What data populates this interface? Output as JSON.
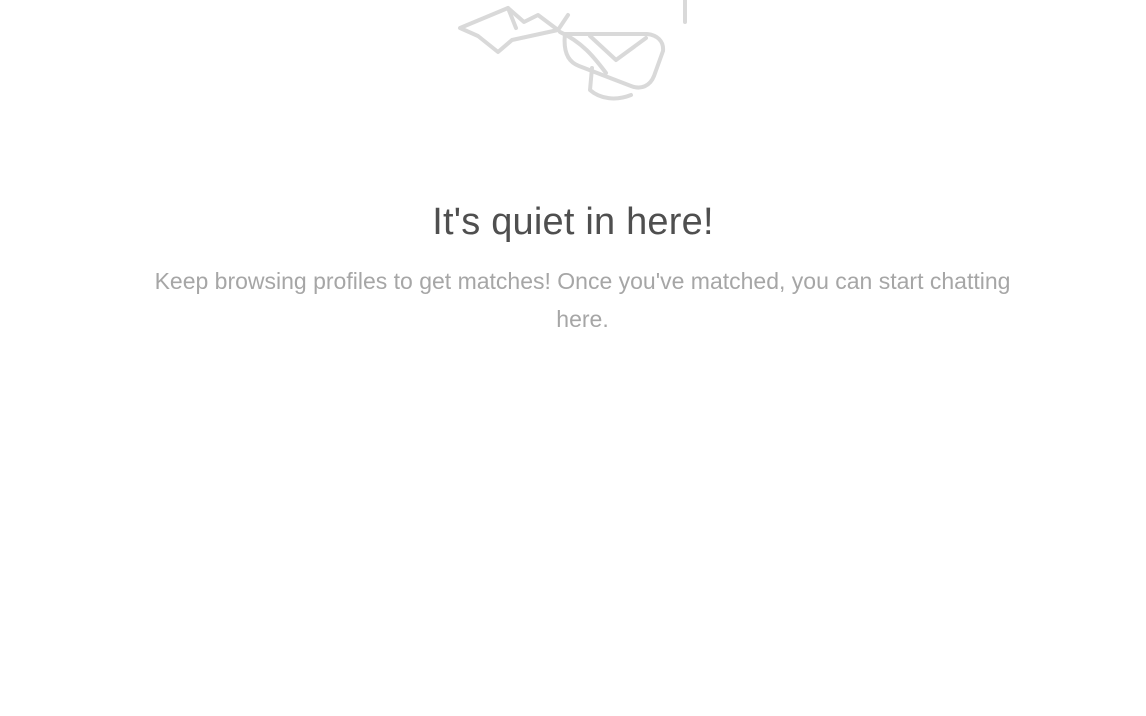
{
  "empty_state": {
    "illustration_icon": "paper-airplane-envelope-icon",
    "title": "It's quiet in here!",
    "message": "Keep browsing profiles to get matches! Once you've matched, you can start chatting here."
  },
  "colors": {
    "background": "#ffffff",
    "title": "#4f4f4f",
    "message": "#a6a6a6",
    "illustration_stroke": "#d9d9d9"
  }
}
